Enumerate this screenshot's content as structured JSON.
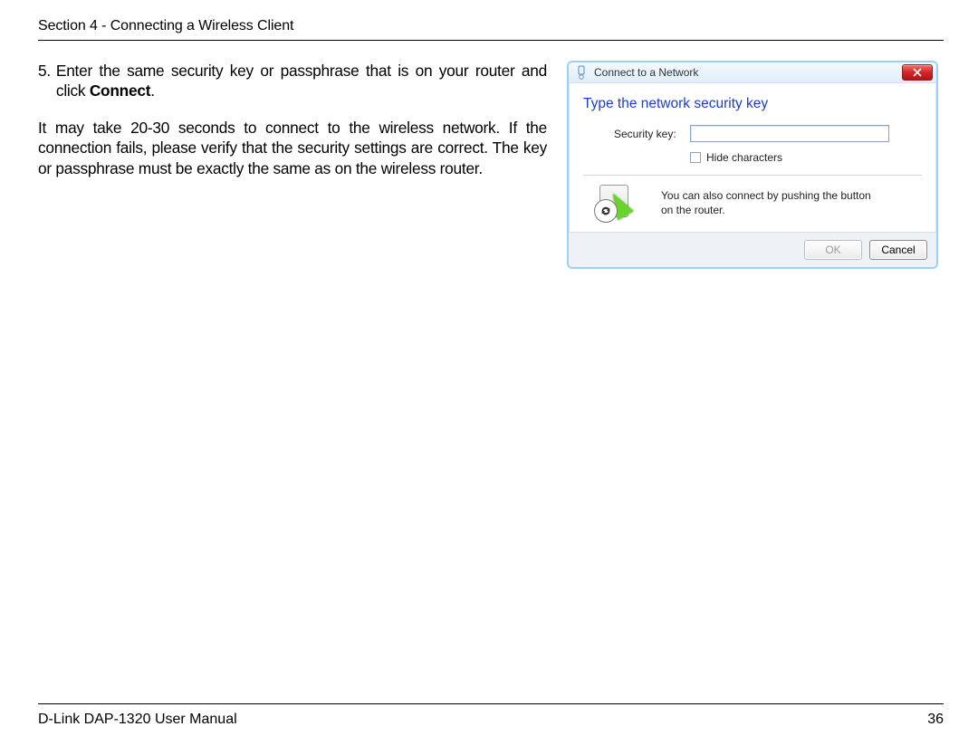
{
  "header": {
    "title": "Section 4 - Connecting a Wireless Client"
  },
  "step": {
    "number": "5.",
    "text_prefix": "Enter the same security key or passphrase that is on your router and click ",
    "bold": "Connect",
    "text_suffix": "."
  },
  "paragraph": "It may take 20-30 seconds to connect to the wireless network. If the connection fails, please verify that the security settings are correct. The key or passphrase must be exactly the same as on the wireless router.",
  "dialog": {
    "title": "Connect to a Network",
    "heading": "Type the network security key",
    "input_label": "Security key:",
    "input_value": "",
    "hide_chars": "Hide characters",
    "hint": "You can also connect by pushing the button on the router.",
    "ok": "OK",
    "cancel": "Cancel"
  },
  "footer": {
    "left": "D-Link DAP-1320 User Manual",
    "right": "36"
  }
}
